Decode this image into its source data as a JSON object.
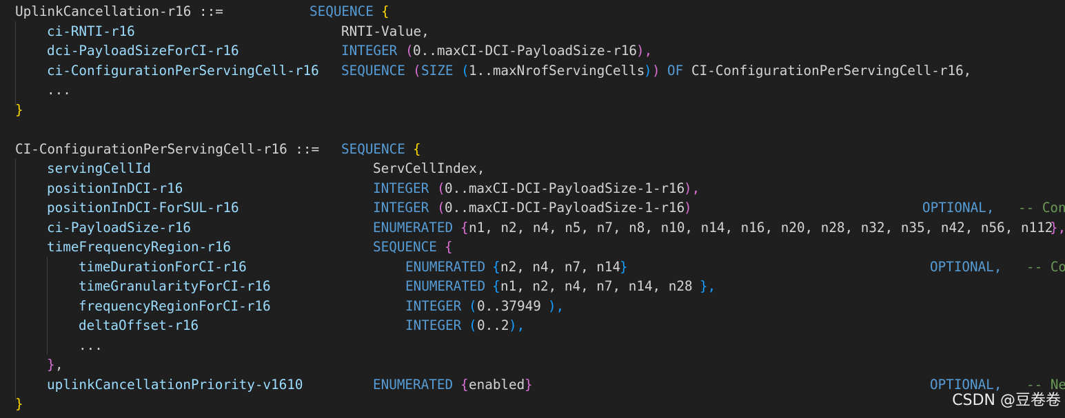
{
  "lines": [
    {
      "segs": [
        [
          "UplinkCancellation-r16 ::=",
          "plain",
          22
        ],
        [
          "SEQUENCE",
          "kw",
          449
        ],
        [
          "{",
          "br1",
          553
        ]
      ]
    },
    {
      "segs": [
        [
          "ci-RNTI-r16",
          "fld",
          68
        ],
        [
          "RNTI-Value,",
          "plain",
          495
        ]
      ]
    },
    {
      "segs": [
        [
          "dci-PayloadSizeForCI-r16",
          "fld",
          68
        ],
        [
          "INTEGER",
          "kw",
          495
        ],
        [
          "(",
          "br2",
          588
        ],
        [
          "0..maxCI-DCI-PayloadSize-r16",
          "plain",
          599
        ],
        [
          "),",
          "br2",
          923
        ]
      ]
    },
    {
      "segs": [
        [
          "ci-ConfigurationPerServingCell-r16",
          "fld",
          68
        ],
        [
          "SEQUENCE",
          "kw",
          495
        ],
        [
          "(",
          "br2",
          599
        ],
        [
          "SIZE",
          "kw",
          611
        ],
        [
          "(",
          "br3",
          669
        ],
        [
          "1..maxNrofServingCells",
          "plain",
          680
        ],
        [
          ")",
          "br3",
          934
        ],
        [
          ")",
          "br2",
          946
        ],
        [
          "OF",
          "kw",
          968
        ],
        [
          "CI-ConfigurationPerServingCell-r16,",
          "plain",
          1003
        ]
      ]
    },
    {
      "segs": [
        [
          "...",
          "plain",
          68
        ]
      ]
    },
    {
      "segs": [
        [
          "}",
          "br1",
          22
        ]
      ]
    },
    {
      "segs": []
    },
    {
      "segs": [
        [
          "CI-ConfigurationPerServingCell-r16 ::=",
          "plain",
          22
        ],
        [
          "SEQUENCE",
          "kw",
          495
        ],
        [
          "{",
          "br1",
          599
        ]
      ]
    },
    {
      "segs": [
        [
          "servingCellId",
          "fld",
          68
        ],
        [
          "ServCellIndex,",
          "plain",
          541
        ]
      ]
    },
    {
      "segs": [
        [
          "positionInDCI-r16",
          "fld",
          68
        ],
        [
          "INTEGER",
          "kw",
          541
        ],
        [
          "(",
          "br2",
          634
        ],
        [
          "0..maxCI-DCI-PayloadSize-1-r16",
          "plain",
          645
        ],
        [
          "),",
          "br2",
          992
        ]
      ]
    },
    {
      "segs": [
        [
          "positionInDCI-ForSUL-r16",
          "fld",
          68
        ],
        [
          "INTEGER",
          "kw",
          541
        ],
        [
          "(",
          "br2",
          634
        ],
        [
          "0..maxCI-DCI-PayloadSize-1-r16",
          "plain",
          645
        ],
        [
          ")",
          "br2",
          992
        ],
        [
          "OPTIONAL,",
          "kw",
          1338
        ],
        [
          "-- Cond",
          "com",
          1477
        ]
      ]
    },
    {
      "segs": [
        [
          "ci-PayloadSize-r16",
          "fld",
          68
        ],
        [
          "ENUMERATED",
          "kw",
          541
        ],
        [
          "{",
          "br2",
          668
        ],
        [
          "n1, n2, n4, n5, n7, n8, n10, n14, n16, n20, n28, n32, n35, n42, n56, n112",
          "plain",
          680
        ],
        [
          "},",
          "br2",
          1523
        ]
      ]
    },
    {
      "segs": [
        [
          "timeFrequencyRegion-r16",
          "fld",
          68
        ],
        [
          "SEQUENCE",
          "kw",
          541
        ],
        [
          "{",
          "br2",
          645
        ]
      ]
    },
    {
      "segs": [
        [
          "timeDurationForCI-r16",
          "fld",
          114
        ],
        [
          "ENUMERATED",
          "kw",
          588
        ],
        [
          "{",
          "br3",
          714
        ],
        [
          "n2, n4, n7, n14",
          "plain",
          726
        ],
        [
          "}",
          "br3",
          899
        ],
        [
          "OPTIONAL,",
          "kw",
          1349
        ],
        [
          "-- Cond",
          "com",
          1489
        ]
      ]
    },
    {
      "segs": [
        [
          "timeGranularityForCI-r16",
          "fld",
          114
        ],
        [
          "ENUMERATED",
          "kw",
          588
        ],
        [
          "{",
          "br3",
          714
        ],
        [
          "n1, n2, n4, n7, n14, n28",
          "plain",
          726
        ],
        [
          "},",
          "br3",
          1015
        ]
      ]
    },
    {
      "segs": [
        [
          "frequencyRegionForCI-r16",
          "fld",
          114
        ],
        [
          "INTEGER",
          "kw",
          588
        ],
        [
          "(",
          "br3",
          680
        ],
        [
          "0..37949",
          "plain",
          692
        ],
        [
          "),",
          "br3",
          795
        ]
      ]
    },
    {
      "segs": [
        [
          "deltaOffset-r16",
          "fld",
          114
        ],
        [
          "INTEGER",
          "kw",
          588
        ],
        [
          "(",
          "br3",
          680
        ],
        [
          "0..2",
          "plain",
          692
        ],
        [
          "),",
          "br3",
          738
        ]
      ]
    },
    {
      "segs": [
        [
          "...",
          "plain",
          114
        ]
      ]
    },
    {
      "segs": [
        [
          "}",
          "br2",
          68
        ],
        [
          ",",
          "plain",
          80
        ]
      ]
    },
    {
      "segs": [
        [
          "uplinkCancellationPriority-v1610",
          "fld",
          68
        ],
        [
          "ENUMERATED",
          "kw",
          541
        ],
        [
          "{",
          "br2",
          668
        ],
        [
          "enabled",
          "plain",
          680
        ],
        [
          "}",
          "br2",
          761
        ],
        [
          "OPTIONAL,",
          "kw",
          1349
        ],
        [
          "-- Need",
          "com",
          1489
        ]
      ]
    },
    {
      "segs": [
        [
          "}",
          "br1",
          22
        ]
      ]
    }
  ],
  "watermark": "CSDN @豆卷卷"
}
